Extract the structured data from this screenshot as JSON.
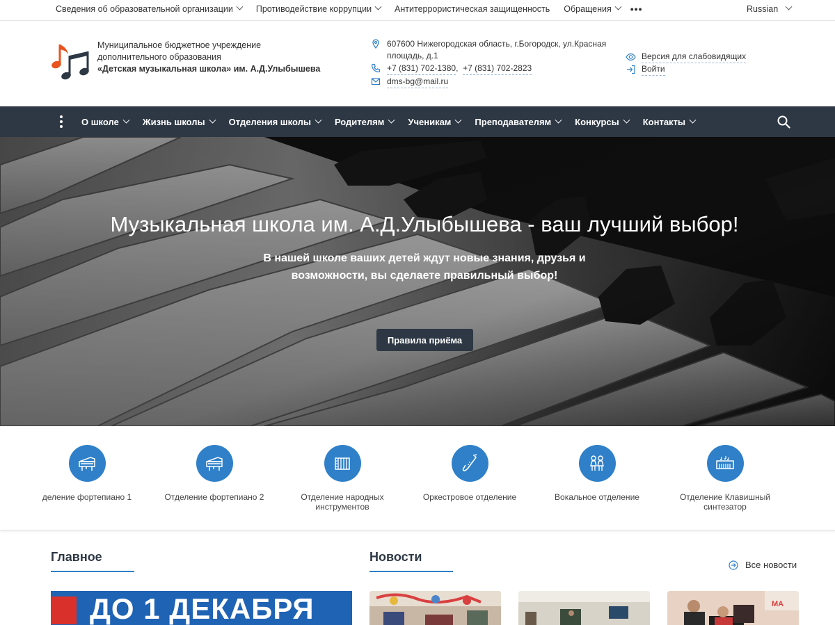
{
  "topbar": {
    "links": [
      {
        "label": "Сведения об образовательной организации",
        "has_dropdown": true
      },
      {
        "label": "Противодействие коррупции",
        "has_dropdown": true
      },
      {
        "label": "Антитеррористическая защищенность",
        "has_dropdown": false
      },
      {
        "label": "Обращения",
        "has_dropdown": true
      }
    ],
    "more": "•••",
    "language": "Russian"
  },
  "header": {
    "org_line1": "Муниципальное бюджетное учреждение",
    "org_line2": "дополнительного образования",
    "org_line3_bold": "«Детская музыкальная школа»",
    "org_line3_rest": " им. А.Д.Улыбышева",
    "address_line1": "607600 Нижегородская область, г.Богородск, ул.Красная",
    "address_line2": "площадь, д.1",
    "phone1": "+7 (831) 702-1380",
    "phone_sep": ",  ",
    "phone2": "+7 (831) 702-2823",
    "email": "dms-bg@mail.ru",
    "accessibility": "Версия для слабовидящих",
    "login": "Войти"
  },
  "nav": {
    "items": [
      "О школе",
      "Жизнь школы",
      "Отделения школы",
      "Родителям",
      "Ученикам",
      "Преподавателям",
      "Конкурсы",
      "Контакты"
    ]
  },
  "hero": {
    "title": "Музыкальная школа им. А.Д.Улыбышева - ваш лучший выбор!",
    "subtitle": "В нашей школе ваших детей ждут новые знания, друзья и возможности, вы сделаете правильный выбор!",
    "button": "Правила приёма"
  },
  "departments": [
    {
      "label": "деление фортепиано 1",
      "icon": "piano-icon"
    },
    {
      "label": "Отделение фортепиано 2",
      "icon": "piano-icon"
    },
    {
      "label": "Отделение народных инструментов",
      "icon": "accordion-icon"
    },
    {
      "label": "Оркестровое отделение",
      "icon": "saxophone-icon"
    },
    {
      "label": "Вокальное отделение",
      "icon": "singers-icon"
    },
    {
      "label": "Отделение Клавишный синтезатор",
      "icon": "synthesizer-icon"
    }
  ],
  "sections": {
    "main_title": "Главное",
    "news_title": "Новости",
    "all_news": "Все новости",
    "banner_text": "ДО 1 ДЕКАБРЯ"
  },
  "colors": {
    "accent": "#2f80c9",
    "nav_bg": "#2d3844",
    "logo_orange": "#e8531f"
  }
}
